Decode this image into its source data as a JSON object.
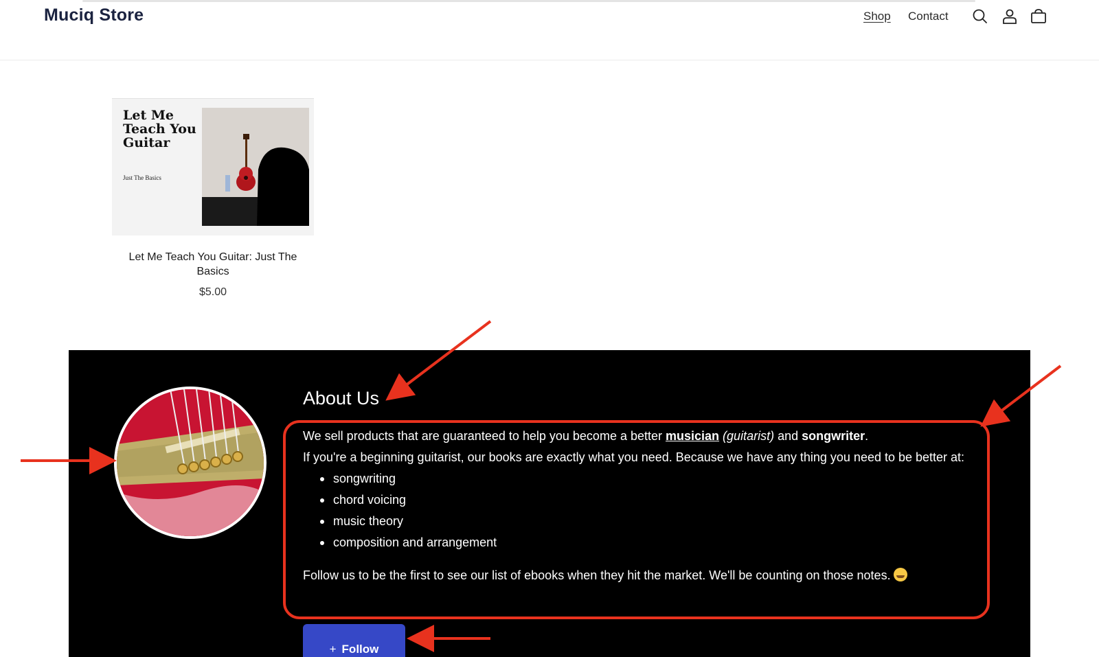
{
  "header": {
    "logo": "Muciq Store",
    "nav": {
      "shop": "Shop",
      "contact": "Contact"
    },
    "icons": [
      "search-icon",
      "account-icon",
      "cart-icon"
    ]
  },
  "product": {
    "cover_title": "Let Me Teach You Guitar",
    "cover_subtitle": "Just The Basics",
    "title": "Let Me Teach You Guitar: Just The Basics",
    "price": "$5.00"
  },
  "about": {
    "title": "About Us",
    "intro_pre": "We sell products that are guaranteed to help you become a better ",
    "intro_link": "musician",
    "intro_italic": "(guitarist)",
    "intro_and": " and ",
    "intro_bold": "songwriter",
    "intro_end": ".",
    "paragraph": "If you're a beginning guitarist, our books are exactly what you need. Because we have any thing you need to be better at:",
    "list": [
      "songwriting",
      "chord voicing",
      "music theory",
      "composition and arrangement"
    ],
    "follow_text": "Follow us to be the first to see our list of ebooks when they hit the market. We'll be counting on those notes.",
    "follow_button": "Follow"
  },
  "colors": {
    "logo": "#1b2340",
    "about_bg": "#000000",
    "follow_button": "#3648c7",
    "annotation": "#e8321e"
  }
}
